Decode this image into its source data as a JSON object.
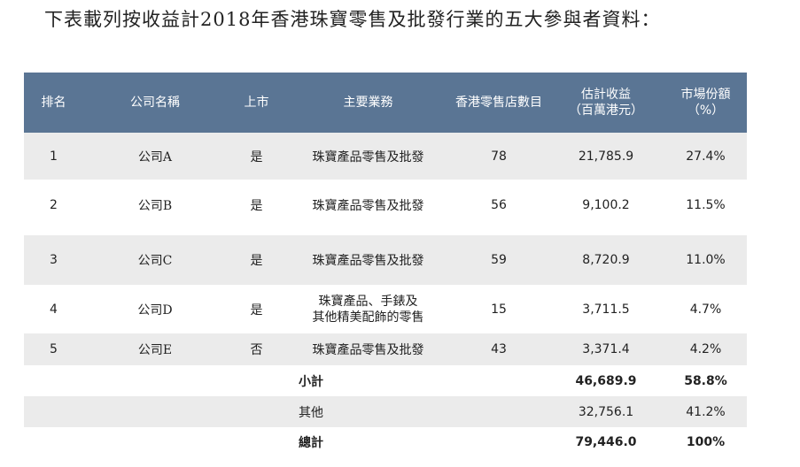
{
  "title": "下表載列按收益計2018年香港珠寶零售及批發行業的五大參與者資料：",
  "headers": {
    "rank": "排名",
    "company": "公司名稱",
    "listed": "上市",
    "business": "主要業務",
    "stores": "香港零售店數目",
    "revenue_l1": "估計收益",
    "revenue_l2": "（百萬港元）",
    "share_l1": "市場份額",
    "share_l2": "（%）"
  },
  "rows": [
    {
      "rank": "1",
      "company": "公司A",
      "listed": "是",
      "business_l1": "珠寶產品零售及批發",
      "business_l2": "",
      "stores": "78",
      "revenue": "21,785.9",
      "share": "27.4%"
    },
    {
      "rank": "2",
      "company": "公司B",
      "listed": "是",
      "business_l1": "珠寶產品零售及批發",
      "business_l2": "",
      "stores": "56",
      "revenue": "9,100.2",
      "share": "11.5%"
    },
    {
      "rank": "3",
      "company": "公司C",
      "listed": "是",
      "business_l1": "珠寶產品零售及批發",
      "business_l2": "",
      "stores": "59",
      "revenue": "8,720.9",
      "share": "11.0%"
    },
    {
      "rank": "4",
      "company": "公司D",
      "listed": "是",
      "business_l1": "珠寶產品、手錶及",
      "business_l2": "其他精美配飾的零售",
      "stores": "15",
      "revenue": "3,711.5",
      "share": "4.7%"
    },
    {
      "rank": "5",
      "company": "公司E",
      "listed": "否",
      "business_l1": "珠寶產品零售及批發",
      "business_l2": "",
      "stores": "43",
      "revenue": "3,371.4",
      "share": "4.2%"
    }
  ],
  "summary": {
    "subtotal_label": "小計",
    "subtotal_revenue": "46,689.9",
    "subtotal_share": "58.8%",
    "other_label": "其他",
    "other_revenue": "32,756.1",
    "other_share": "41.2%",
    "total_label": "總計",
    "total_revenue": "79,446.0",
    "total_share": "100%"
  },
  "colors": {
    "header_bg": "#5a7594",
    "shade_bg": "#ebebeb"
  }
}
